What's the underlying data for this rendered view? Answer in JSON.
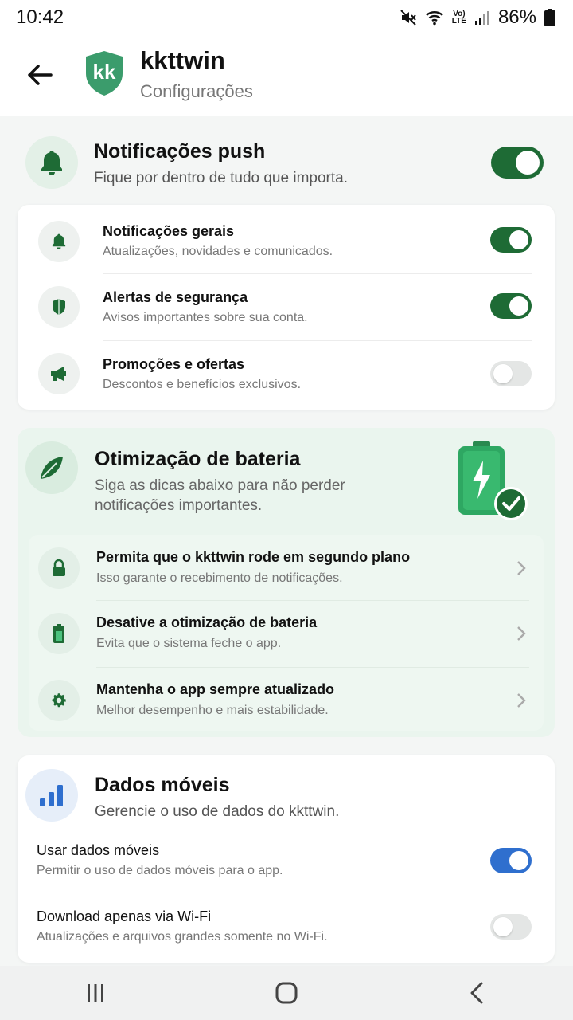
{
  "status_bar": {
    "time": "10:42",
    "volte_top": "Vo)",
    "volte_bottom": "LTE",
    "battery": "86%"
  },
  "header": {
    "title": "kkttwin",
    "subtitle": "Configurações",
    "logo_text": "kk",
    "brand_color": "#3b9c6c"
  },
  "push": {
    "title": "Notificações push",
    "subtitle": "Fique por dentro de tudo que importa.",
    "enabled": true,
    "items": [
      {
        "title": "Notificações gerais",
        "subtitle": "Atualizações, novidades e comunicados.",
        "icon": "bell-icon",
        "enabled": true
      },
      {
        "title": "Alertas de segurança",
        "subtitle": "Avisos importantes sobre sua conta.",
        "icon": "shield-icon",
        "enabled": true
      },
      {
        "title": "Promoções e ofertas",
        "subtitle": "Descontos e benefícios exclusivos.",
        "icon": "megaphone-icon",
        "enabled": false
      }
    ]
  },
  "battery": {
    "title": "Otimização de bateria",
    "subtitle_line1": "Siga as dicas abaixo para não perder",
    "subtitle_line2": "notificações importantes.",
    "items": [
      {
        "title": "Permita que o kkttwin rode em segundo plano",
        "subtitle": "Isso garante o recebimento de notificações.",
        "icon": "lock-icon"
      },
      {
        "title": "Desative a otimização de bateria",
        "subtitle": "Evita que o sistema feche o app.",
        "icon": "battery-icon"
      },
      {
        "title": "Mantenha o app sempre atualizado",
        "subtitle": "Melhor desempenho e mais estabilidade.",
        "icon": "gear-icon"
      }
    ]
  },
  "mobile_data": {
    "title": "Dados móveis",
    "subtitle": "Gerencie o uso de dados do kkttwin.",
    "items": [
      {
        "title": "Usar dados móveis",
        "subtitle": "Permitir o uso de dados móveis para o app.",
        "enabled": true
      },
      {
        "title": "Download apenas via Wi-Fi",
        "subtitle": "Atualizações e arquivos grandes somente no Wi-Fi.",
        "enabled": false
      }
    ]
  },
  "colors": {
    "accent_green": "#1e6b35",
    "accent_blue": "#2f6fce",
    "toggle_off": "#e4e6e5"
  }
}
